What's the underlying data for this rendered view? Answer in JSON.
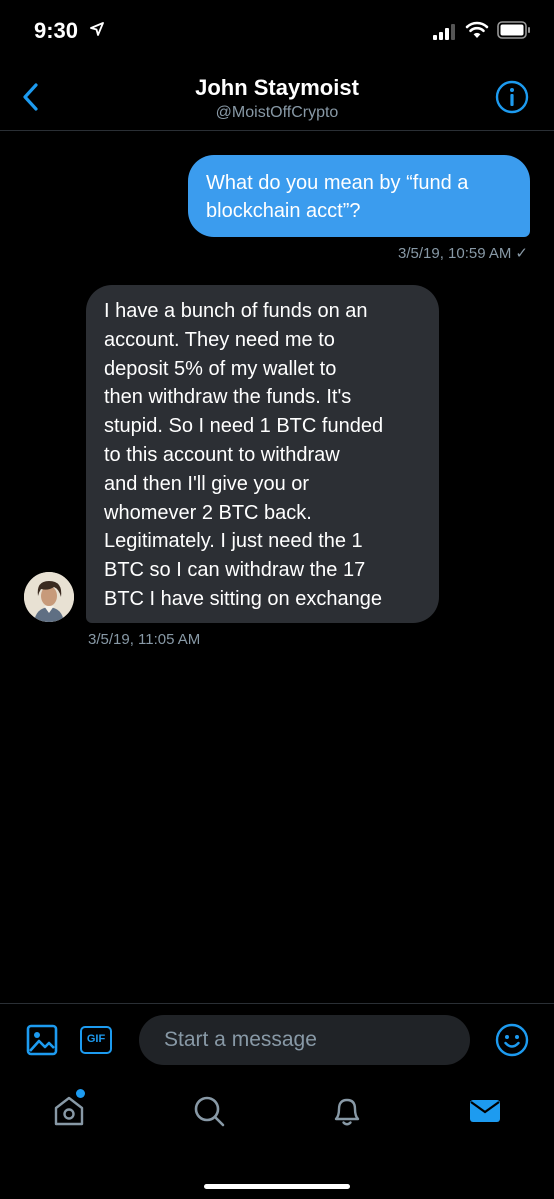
{
  "status_bar": {
    "time": "9:30",
    "icons": [
      "location-arrow-icon",
      "signal-bars-icon",
      "wifi-icon",
      "battery-icon"
    ]
  },
  "header": {
    "title": "John Staymoist",
    "handle": "@MoistOffCrypto",
    "icons": [
      "back-chevron-icon",
      "info-icon"
    ]
  },
  "messages": [
    {
      "direction": "outgoing",
      "lines": [
        "What do you mean by “fund a",
        "blockchain acct”?"
      ],
      "timestamp": "3/5/19, 10:59 AM",
      "status_icon": "sent-check-icon"
    },
    {
      "direction": "incoming",
      "lines": [
        "I have a bunch of funds on an",
        "account. They need me to",
        "deposit 5% of my wallet to",
        "then withdraw the funds. It's",
        "stupid. So I need 1 BTC funded",
        "to this account to withdraw",
        "and then I'll give you or",
        "whomever 2 BTC back.",
        "Legitimately. I just need the 1",
        "BTC so I can withdraw the 17",
        "BTC I have sitting on exchange"
      ],
      "timestamp": "3/5/19, 11:05 AM"
    }
  ],
  "composer": {
    "placeholder": "Start a message",
    "gif_label": "GIF",
    "icons": [
      "image-icon",
      "gif-icon",
      "emoji-icon"
    ]
  },
  "tab_bar": {
    "items": [
      "home-icon",
      "search-icon",
      "notifications-icon",
      "messages-icon"
    ],
    "active": "messages-icon",
    "home_has_notification_dot": true
  },
  "colors": {
    "background": "#000000",
    "accent": "#1d9bf0",
    "outgoing_bubble": "#3b9cee",
    "incoming_bubble": "#2c2f34",
    "secondary_text": "#8899a6",
    "input_background": "#202327"
  }
}
